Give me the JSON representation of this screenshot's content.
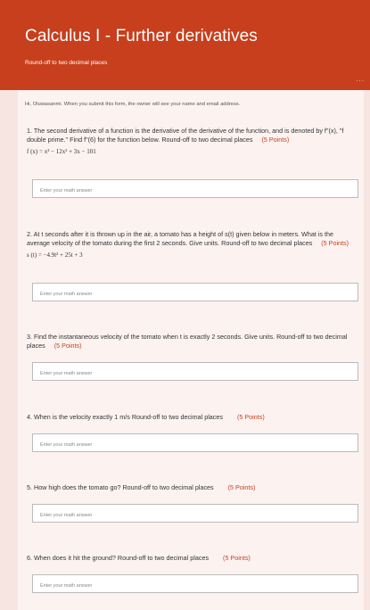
{
  "form": {
    "title": "Calculus I - Further derivatives",
    "subtitle": "Round-off to two decimal places",
    "more": "...",
    "greeting": "Hi, Oluwasanmi. When you submit this form, the owner will see your name and email address.",
    "answer_placeholder": "Enter your math answer"
  },
  "questions": [
    {
      "number": "1.",
      "text": "The second derivative of a function is the derivative of the derivative of the function, and is denoted by f\"(x), \"f double prime.\" Find f\"(6) for the function below. Round-off to two decimal places",
      "points": "(5 Points)",
      "math": "f (x) = x³ − 12x² + 3x − 101"
    },
    {
      "number": "2.",
      "text": "At t seconds after it is thrown up in the air, a tomato has a height of s(t) given below in meters. What is the average velocity of the tomato during the first 2 seconds. Give units. Round-off to two decimal places",
      "points": "(5 Points)",
      "math": "s (t) = −4.9t² + 25t + 3"
    },
    {
      "number": "3.",
      "text": "Find the instantaneous velocity of the tomato when t is exactly 2 seconds. Give units. Round-off to two decimal places",
      "points": "(5 Points)",
      "math": ""
    },
    {
      "number": "4.",
      "text": "When is the velocity exactly 1 m/s Round-off to two decimal places",
      "points": "(5 Points)",
      "math": ""
    },
    {
      "number": "5.",
      "text": "How high does the tomato go? Round-off to two decimal places",
      "points": "(5 Points)",
      "math": ""
    },
    {
      "number": "6.",
      "text": "When does it hit the ground? Round-off to two decimal places",
      "points": "(5 Points)",
      "math": ""
    }
  ]
}
